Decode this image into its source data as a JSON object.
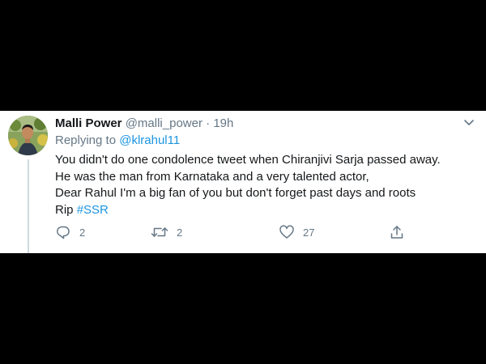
{
  "tweet": {
    "display_name": "Malli Power",
    "handle": "@malli_power",
    "separator": "·",
    "time": "19h",
    "replying_prefix": "Replying to",
    "replying_to": "@klrahul11",
    "body_lines": [
      "You didn't do one condolence tweet when Chiranjivi Sarja passed away.",
      "He was the man from Karnataka and a very talented actor,",
      "Dear Rahul I'm a big fan of you but don't forget past days and roots"
    ],
    "last_line_prefix": "Rip",
    "hashtag": "#SSR"
  },
  "actions": {
    "reply_count": "2",
    "retweet_count": "2",
    "like_count": "27"
  },
  "icons": {
    "reply": "reply-icon",
    "retweet": "retweet-icon",
    "like": "heart-icon",
    "share": "share-icon",
    "menu": "chevron-down-icon"
  },
  "colors": {
    "background": "#000000",
    "card": "#ffffff",
    "link": "#1b95e0",
    "muted": "#657786",
    "text": "#14171a"
  }
}
